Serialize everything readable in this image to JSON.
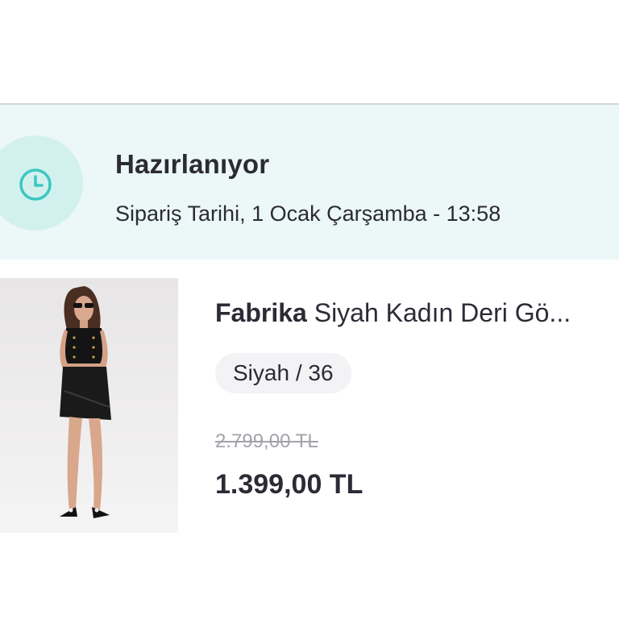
{
  "order_status": {
    "title": "Hazırlanıyor",
    "date_text": "Sipariş Tarihi, 1 Ocak Çarşamba - 13:58",
    "icon": "clock-icon",
    "accent_color": "#3cc7c0",
    "banner_color": "#ecf7f8"
  },
  "product": {
    "brand": "Fabrika",
    "name": "Siyah Kadın Deri Gö...",
    "variant": "Siyah / 36",
    "old_price": "2.799,00 TL",
    "price": "1.399,00 TL",
    "image_alt": "product-photo"
  }
}
